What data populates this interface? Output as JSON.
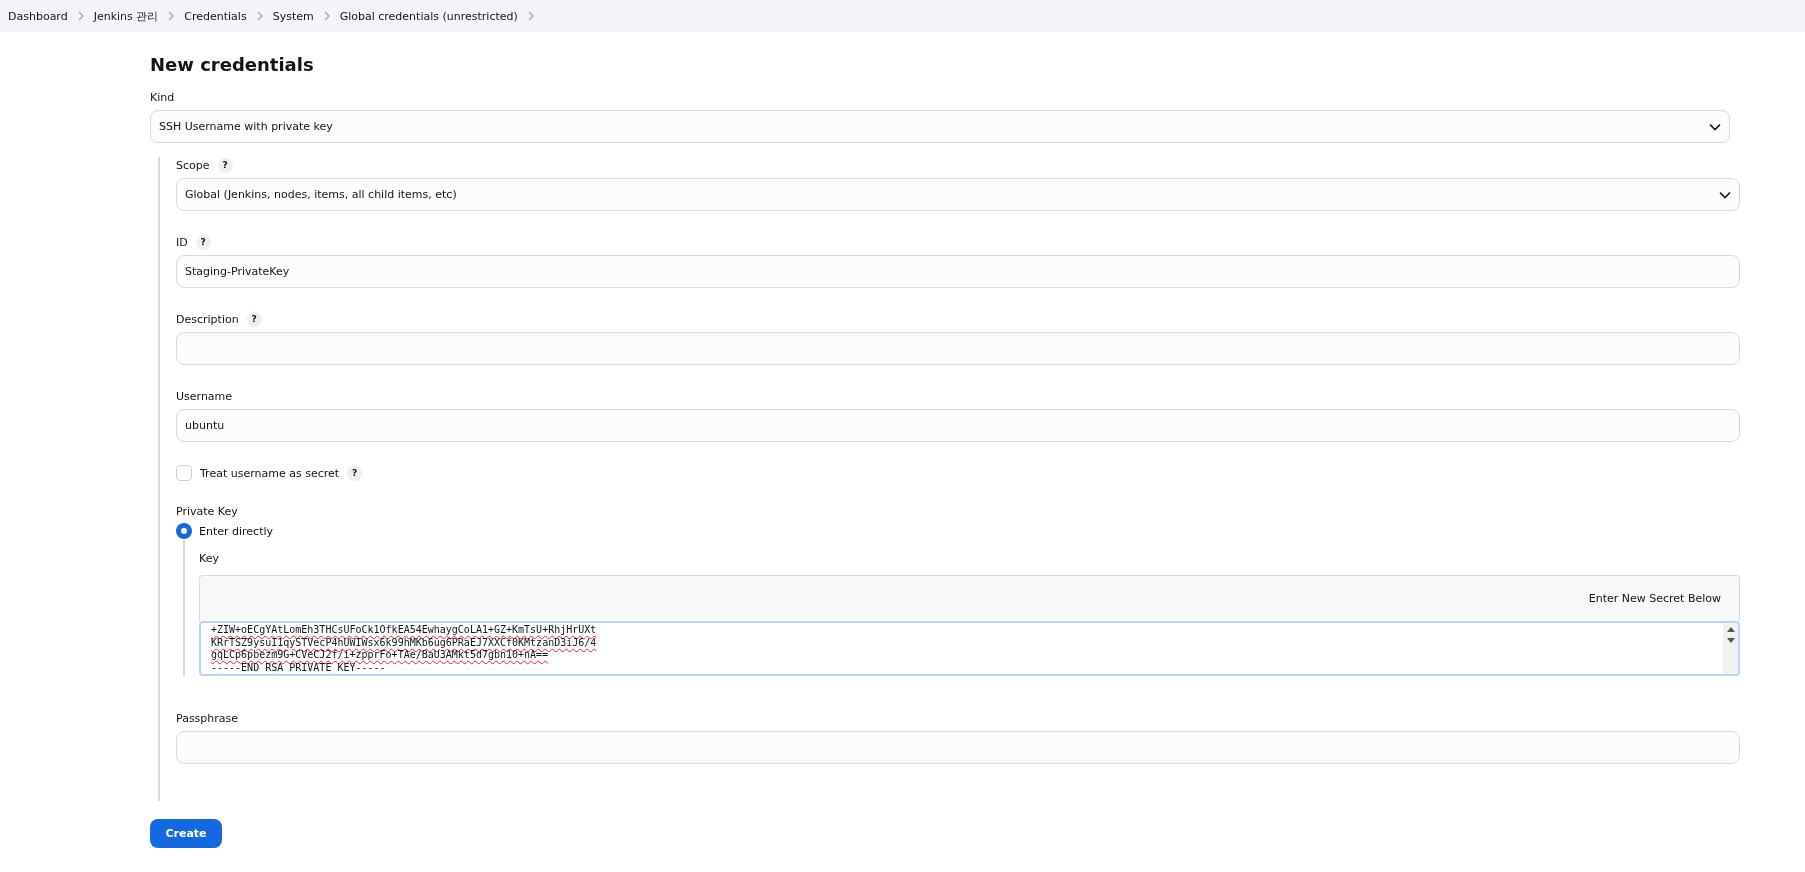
{
  "breadcrumbs": [
    "Dashboard",
    "Jenkins 관리",
    "Credentials",
    "System",
    "Global credentials (unrestricted)"
  ],
  "title": "New credentials",
  "kind": {
    "label": "Kind",
    "value": "SSH Username with private key"
  },
  "fields": [
    {
      "kind": "select",
      "label": "Scope",
      "help": "?",
      "value": "Global (Jenkins, nodes, items, all child items, etc)"
    },
    {
      "kind": "text",
      "label": "ID",
      "help": "?",
      "value": "Staging-PrivateKey"
    },
    {
      "kind": "text",
      "label": "Description",
      "help": "?"
    },
    {
      "kind": "text",
      "label": "Username",
      "value": "ubuntu"
    },
    {
      "kind": "checkbox",
      "label": "Treat username as secret",
      "help": "?",
      "checked": false
    },
    {
      "kind": "private_key",
      "label": "Private Key",
      "option": {
        "label": "Enter directly",
        "selected": true
      },
      "key_label": "Key",
      "secret_note": "Enter New Secret Below",
      "key_lines": [
        "+ZIW+oECgYAtLomEh3THCsUFoCk1OfkEA54EwhaygCoLA1+GZ+KmTsU+RhjHrUXt",
        "KRrTSZ9ysuI1qySTVecP4hUWIWsx6k99hMKb6ug6PRaEJ7XXCf0KMtzanD3iJ6/4",
        "gqLCp6pbezm9G+CVeCJ2f/i+zpprFo+TAe/BaU3AMkt5d7gbn10+nA==",
        "-----END RSA PRIVATE KEY-----"
      ]
    },
    {
      "kind": "password",
      "label": "Passphrase"
    }
  ],
  "create_button": "Create"
}
